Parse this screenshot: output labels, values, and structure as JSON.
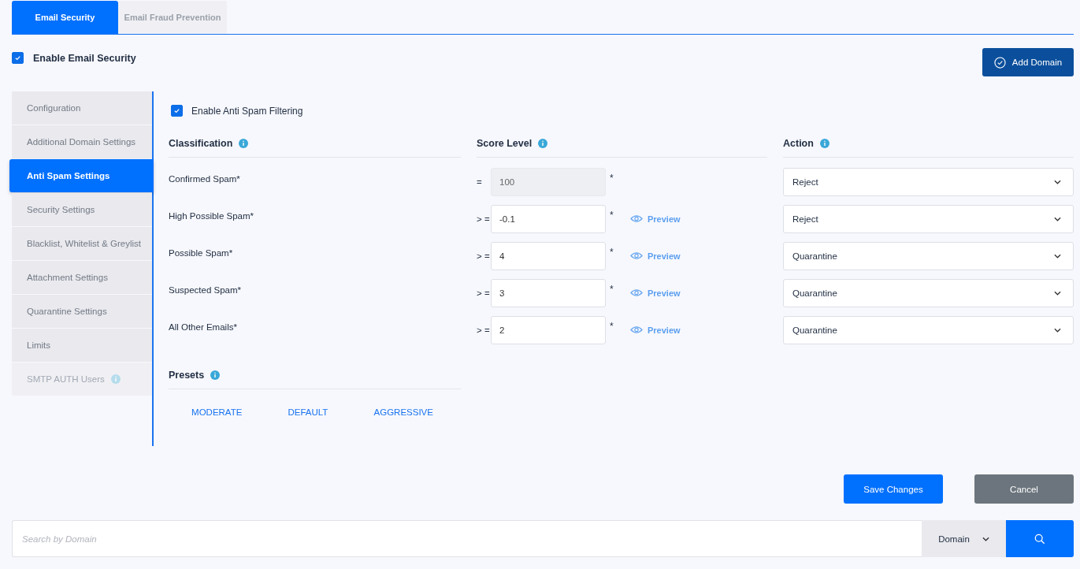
{
  "tabs": [
    {
      "label": "Email Security",
      "selected": true
    },
    {
      "label": "Email Fraud Prevention",
      "selected": false
    }
  ],
  "enable_email_security": {
    "label": "Enable Email Security",
    "checked": true
  },
  "add_domain_button": "Add Domain",
  "sidebar": {
    "items": [
      {
        "label": "Configuration",
        "selected": false,
        "disabled": false,
        "info": false
      },
      {
        "label": "Additional Domain Settings",
        "selected": false,
        "disabled": false,
        "info": false
      },
      {
        "label": "Anti Spam Settings",
        "selected": true,
        "disabled": false,
        "info": false
      },
      {
        "label": "Security Settings",
        "selected": false,
        "disabled": false,
        "info": false
      },
      {
        "label": "Blacklist, Whitelist & Greylist",
        "selected": false,
        "disabled": false,
        "info": false
      },
      {
        "label": "Attachment Settings",
        "selected": false,
        "disabled": false,
        "info": false
      },
      {
        "label": "Quarantine Settings",
        "selected": false,
        "disabled": false,
        "info": false
      },
      {
        "label": "Limits",
        "selected": false,
        "disabled": false,
        "info": false
      },
      {
        "label": "SMTP AUTH Users",
        "selected": false,
        "disabled": true,
        "info": true
      }
    ]
  },
  "anti_spam": {
    "enable": {
      "label": "Enable Anti Spam Filtering",
      "checked": true
    },
    "headers": [
      "Classification",
      "Score Level",
      "Action"
    ],
    "rows": [
      {
        "classification": "Confirmed Spam*",
        "operator": "=",
        "score": "100",
        "disabled": true,
        "required_mark": "*",
        "action": "Reject"
      },
      {
        "classification": "High Possible Spam*",
        "operator": "> =",
        "score": "-0.1",
        "disabled": false,
        "required_mark": "*",
        "preview": "Preview",
        "action": "Reject"
      },
      {
        "classification": "Possible Spam*",
        "operator": "> =",
        "score": "4",
        "disabled": false,
        "required_mark": "*",
        "preview": "Preview",
        "action": "Quarantine"
      },
      {
        "classification": "Suspected Spam*",
        "operator": "> =",
        "score": "3",
        "disabled": false,
        "required_mark": "*",
        "preview": "Preview",
        "action": "Quarantine"
      },
      {
        "classification": "All Other Emails*",
        "operator": "> =",
        "score": "2",
        "disabled": false,
        "required_mark": "*",
        "preview": "Preview",
        "action": "Quarantine"
      }
    ],
    "presets": {
      "title": "Presets",
      "buttons": [
        "MODERATE",
        "DEFAULT",
        "AGGRESSIVE"
      ]
    }
  },
  "save_button": "Save Changes",
  "cancel_button": "Cancel",
  "search": {
    "placeholder": "Search by Domain",
    "filter": "Domain"
  }
}
